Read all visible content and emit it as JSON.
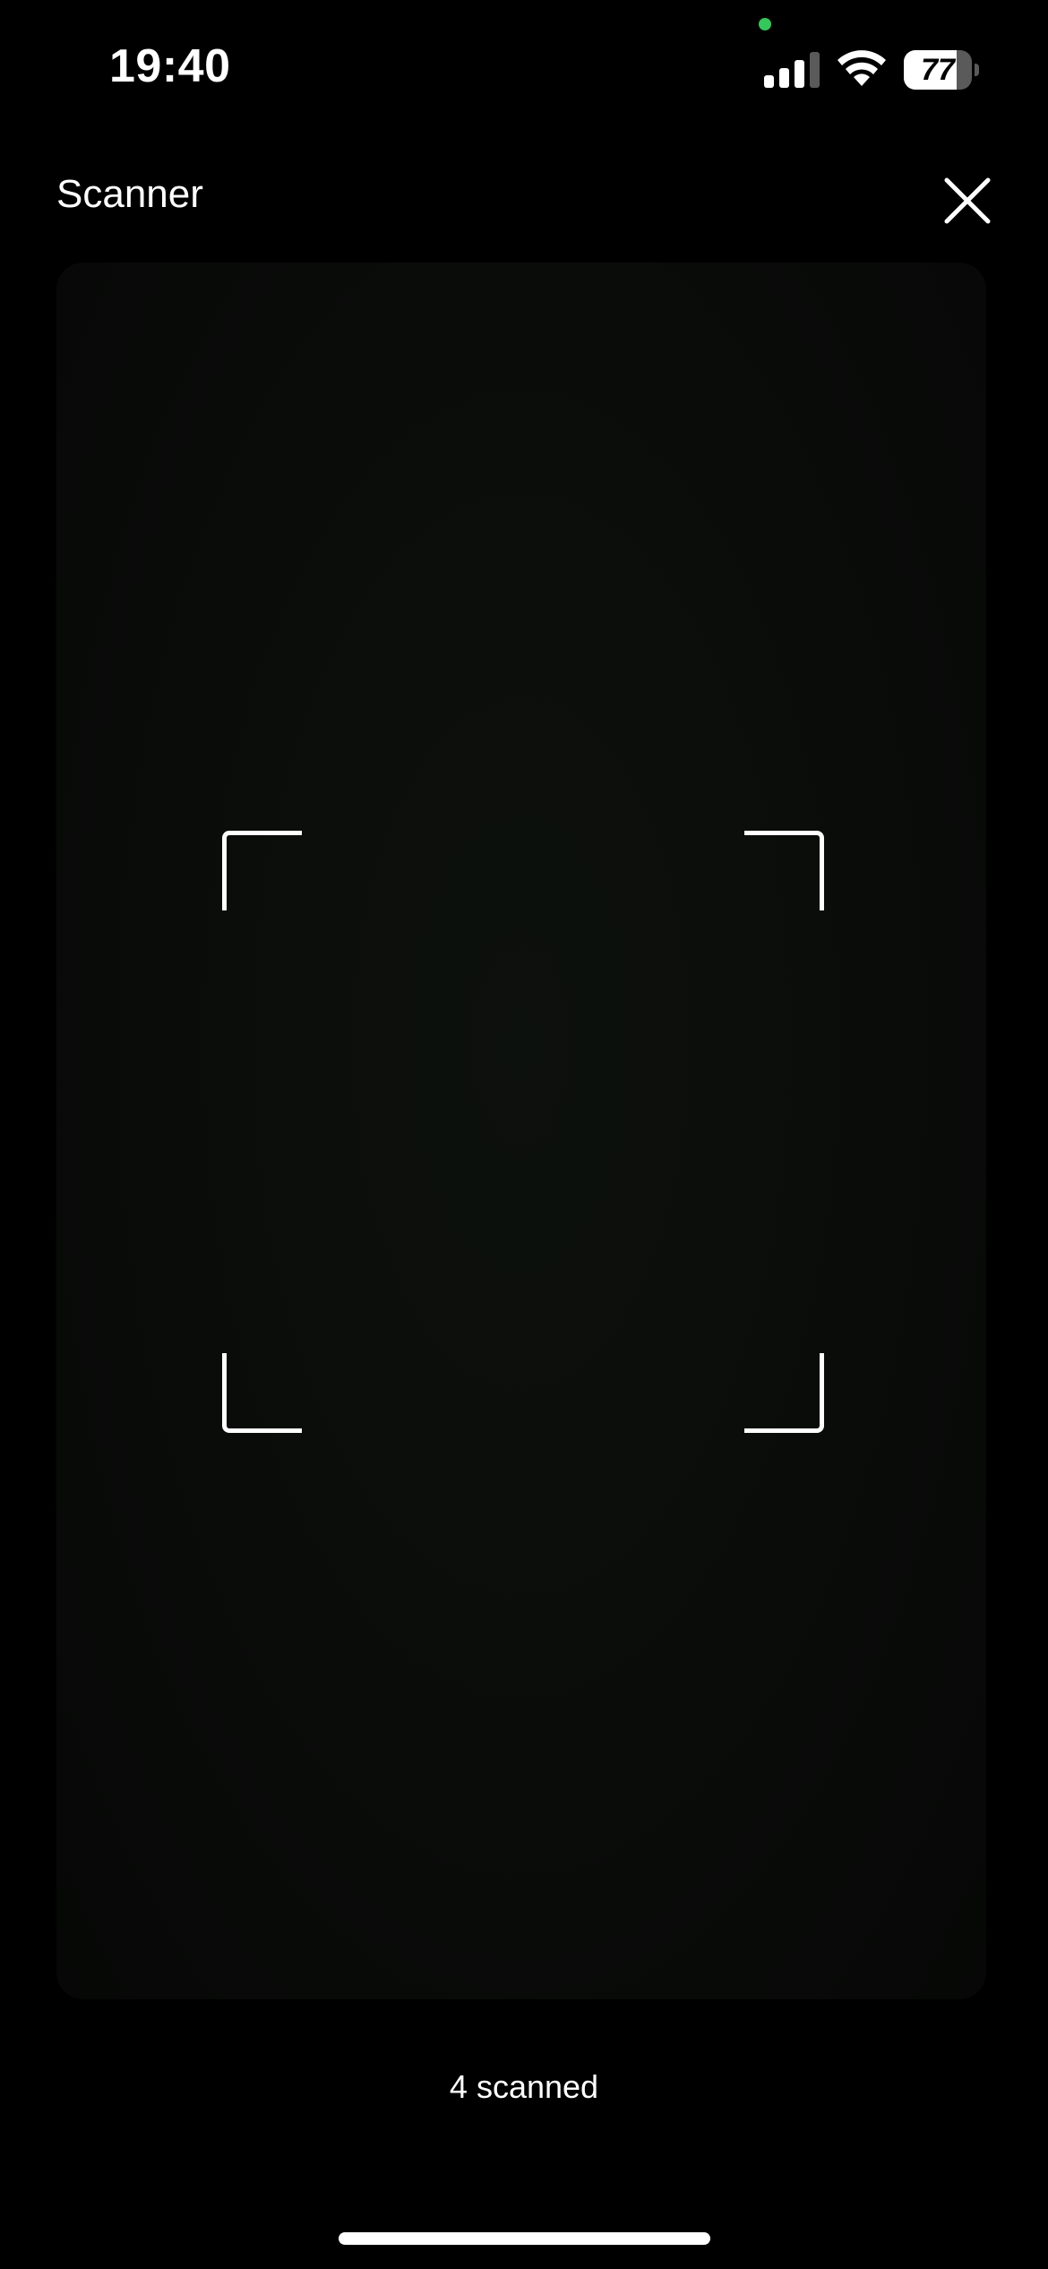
{
  "status_bar": {
    "time": "19:40",
    "battery_level": "77",
    "battery_fraction": 0.77,
    "privacy_indicator_color": "#34c759",
    "icons": [
      "signal-icon",
      "wifi-icon",
      "battery-icon"
    ]
  },
  "header": {
    "title": "Scanner",
    "close_icon": "close-icon"
  },
  "scanner": {
    "count_label": "4 scanned"
  },
  "colors": {
    "background": "#000000",
    "foreground": "#ffffff",
    "viewport": "#0a0c0a"
  }
}
